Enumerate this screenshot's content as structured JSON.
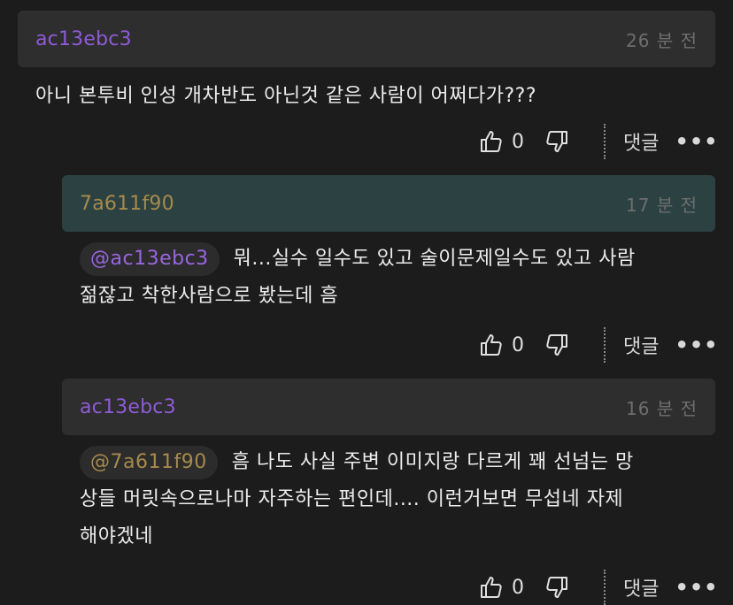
{
  "colors": {
    "author_purple": "#8e5bd6",
    "author_gold": "#a68a4c",
    "mention_purple": "#9a66e0",
    "mention_gold": "#a68a4c"
  },
  "comments": [
    {
      "author": "ac13ebc3",
      "time": "26 분 전",
      "text": "아니 본투비 인성 개차반도 아닌것 같은 사람이 어쩌다가???",
      "likes": "0",
      "reply_label": "댓글",
      "more": "•••"
    },
    {
      "author": "7a611f90",
      "time": "17 분 전",
      "mention": "@ac13ebc3",
      "text_line1": "뭐...실수 일수도 있고 술이문제일수도 있고 사람",
      "text_line2": "젊잖고 착한사람으로 봤는데 흠",
      "likes": "0",
      "reply_label": "댓글",
      "more": "•••"
    },
    {
      "author": "ac13ebc3",
      "time": "16 분 전",
      "mention": "@7a611f90",
      "text_line1": "흠 나도 사실 주변 이미지랑 다르게 꽤 선넘는 망",
      "text_line2": "상들 머릿속으로나마 자주하는 편인데.... 이런거보면 무섭네 자제",
      "text_line3": "해야겠네",
      "likes": "0",
      "reply_label": "댓글",
      "more": "•••"
    }
  ]
}
